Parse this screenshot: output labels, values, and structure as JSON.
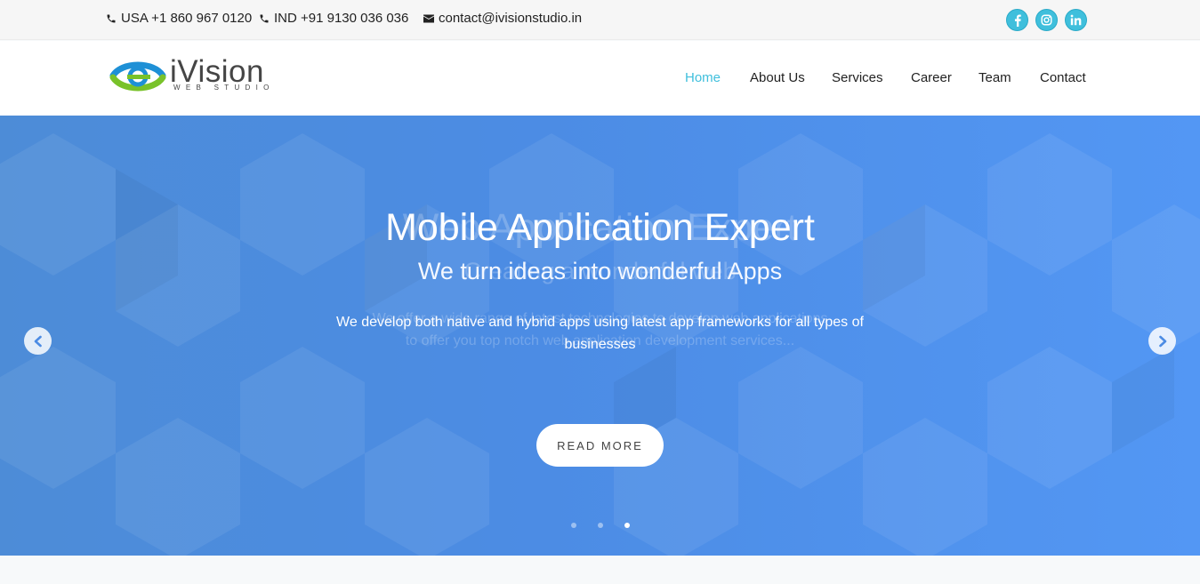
{
  "topbar": {
    "phone_usa": "USA +1 860 967 0120",
    "phone_ind": "IND +91 9130 036 036",
    "email": "contact@ivisionstudio.in",
    "icons": [
      "phone-icon",
      "envelope-icon",
      "facebook-icon",
      "instagram-icon",
      "linkedin-icon"
    ],
    "social": [
      "f",
      "ig",
      "in"
    ]
  },
  "header": {
    "logo_text": "iVision",
    "logo_sub": "WEB STUDIO",
    "nav": [
      {
        "label": "Home",
        "active": true
      },
      {
        "label": "About Us",
        "active": false
      },
      {
        "label": "Services",
        "active": false
      },
      {
        "label": "Career",
        "active": false
      },
      {
        "label": "Team",
        "active": false
      },
      {
        "label": "Contact",
        "active": false
      }
    ]
  },
  "hero": {
    "title": "Mobile Application Expert",
    "subtitle": "We turn ideas into wonderful Apps",
    "description": "We develop both native and hybrid apps using latest app frameworks for all types of businesses",
    "ghost_title": "Web Application Expert",
    "ghost_subtitle": "Creating a wonderful web",
    "ghost_desc_line1": "We offer a wide range of latest technologies to develop web applications",
    "ghost_desc_line2": "to offer you top notch web application development services...",
    "button": "READ MORE",
    "slides_total": 3,
    "slide_active": 3
  },
  "colors": {
    "accent": "#3fbfdc",
    "hero_blue": "#4c8ce4",
    "logo_blue": "#1e90d6",
    "logo_green": "#79c22a",
    "text_dark": "#222222"
  }
}
